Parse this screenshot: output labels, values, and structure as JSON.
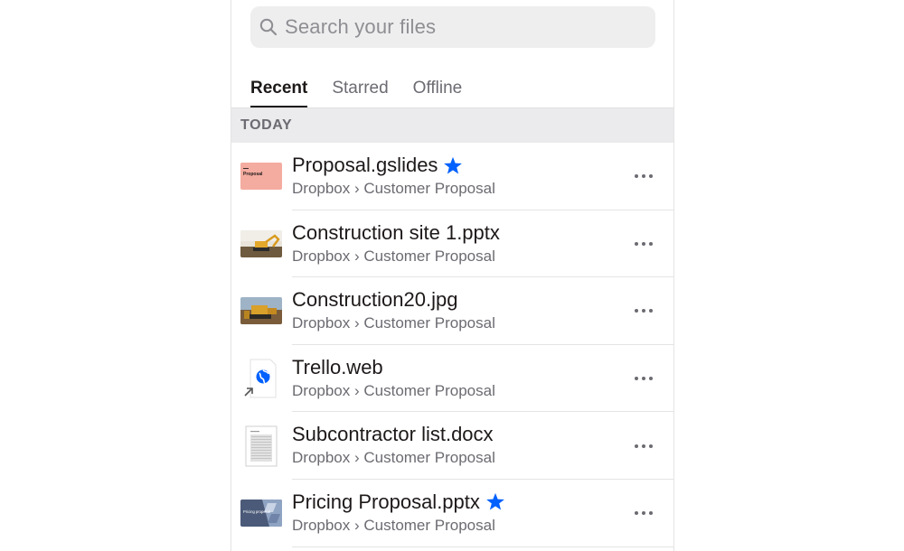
{
  "search": {
    "placeholder": "Search your files",
    "icon": "search-icon"
  },
  "tabs": [
    {
      "label": "Recent",
      "active": true
    },
    {
      "label": "Starred",
      "active": false
    },
    {
      "label": "Offline",
      "active": false
    }
  ],
  "section": {
    "label": "TODAY"
  },
  "files": [
    {
      "name": "Proposal.gslides",
      "path": "Dropbox › Customer Proposal",
      "starred": true,
      "thumb": "slides-thumbnail",
      "thumb_text": "Proposal"
    },
    {
      "name": "Construction site 1.pptx",
      "path": "Dropbox › Customer Proposal",
      "starred": false,
      "thumb": "excavator-photo-thumbnail"
    },
    {
      "name": "Construction20.jpg",
      "path": "Dropbox › Customer Proposal",
      "starred": false,
      "thumb": "bulldozer-photo-thumbnail"
    },
    {
      "name": "Trello.web",
      "path": "Dropbox › Customer Proposal",
      "starred": false,
      "thumb": "web-shortcut-icon"
    },
    {
      "name": "Subcontractor list.docx",
      "path": "Dropbox › Customer Proposal",
      "starred": false,
      "thumb": "document-thumbnail"
    },
    {
      "name": "Pricing Proposal.pptx",
      "path": "Dropbox › Customer Proposal",
      "starred": true,
      "thumb": "pricing-slides-thumbnail",
      "thumb_text": "Pricing proposal"
    }
  ],
  "colors": {
    "accent_star": "#0061fe",
    "text_primary": "#1e1919",
    "text_secondary": "#6b6b72",
    "search_bg": "#eeeeef",
    "section_bg": "#ebebed"
  }
}
